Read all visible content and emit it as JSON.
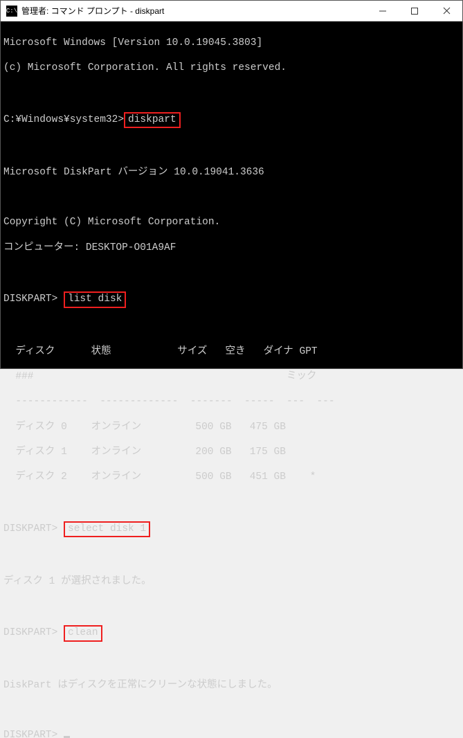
{
  "titlebar": {
    "icon_text": "C:\\",
    "title": "管理者: コマンド プロンプト - diskpart"
  },
  "term": {
    "ver1": "Microsoft Windows [Version 10.0.19045.3803]",
    "ver2": "(c) Microsoft Corporation. All rights reserved.",
    "prompt1a": "C:¥Windows¥system32>",
    "cmd1": "diskpart",
    "dpver": "Microsoft DiskPart バージョン 10.0.19041.3636",
    "copy": "Copyright (C) Microsoft Corporation.",
    "comp": "コンピューター: DESKTOP-O01A9AF",
    "dp": "DISKPART>",
    "cmd2": "list disk",
    "hdr1": "  ディスク      状態           サイズ   空き   ダイナ GPT",
    "hdr2": "  ###                                          ミック",
    "sep": "  ------------  -------------  -------  -----  ---  ---",
    "row0": "  ディスク 0    オンライン         500 GB   475 GB",
    "row1": "  ディスク 1    オンライン         200 GB   175 GB",
    "row2": "  ディスク 2    オンライン         500 GB   451 GB    *",
    "cmd3": "select disk 1",
    "sel": "ディスク 1 が選択されました。",
    "cmd4": "clean",
    "cleaned": "DiskPart はディスクを正常にクリーンな状態にしました。"
  }
}
